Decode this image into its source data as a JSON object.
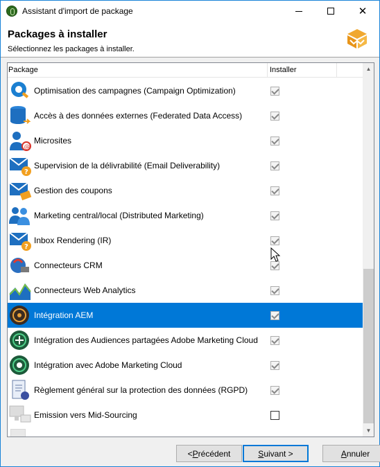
{
  "window": {
    "title": "Assistant d'import de package",
    "buttons": {
      "minimize": "minimize-icon",
      "maximize": "maximize-icon",
      "close": "close-icon"
    }
  },
  "header": {
    "title": "Packages à installer",
    "subtitle": "Sélectionnez les packages à installer.",
    "logo": "package-box-icon"
  },
  "list": {
    "columns": {
      "package": "Package",
      "install": "Installer"
    },
    "rows": [
      {
        "label": "Optimisation des campagnes (Campaign Optimization)",
        "icon": "campaign-optimization-icon",
        "checked": true,
        "selected": false
      },
      {
        "label": "Accès à des données externes (Federated Data Access)",
        "icon": "database-icon",
        "checked": true,
        "selected": false
      },
      {
        "label": "Microsites",
        "icon": "user-at-icon",
        "checked": true,
        "selected": false
      },
      {
        "label": "Supervision de la délivrabilité (Email Deliverability)",
        "icon": "mail-question-icon",
        "checked": true,
        "selected": false
      },
      {
        "label": "Gestion des coupons",
        "icon": "mail-coupon-icon",
        "checked": true,
        "selected": false
      },
      {
        "label": "Marketing central/local (Distributed Marketing)",
        "icon": "users-icon",
        "checked": true,
        "selected": false
      },
      {
        "label": "Inbox Rendering (IR)",
        "icon": "mail-question-icon",
        "checked": true,
        "selected": false
      },
      {
        "label": "Connecteurs CRM",
        "icon": "crm-connector-icon",
        "checked": true,
        "selected": false
      },
      {
        "label": "Connecteurs Web Analytics",
        "icon": "web-analytics-icon",
        "checked": true,
        "selected": false
      },
      {
        "label": "Intégration AEM",
        "icon": "aem-icon",
        "checked": true,
        "selected": true
      },
      {
        "label": "Intégration des Audiences partagées Adobe Marketing Cloud",
        "icon": "audience-icon",
        "checked": true,
        "selected": false
      },
      {
        "label": "Intégration avec Adobe Marketing Cloud",
        "icon": "marketing-cloud-icon",
        "checked": true,
        "selected": false
      },
      {
        "label": "Règlement général sur la protection des données (RGPD)",
        "icon": "gdpr-document-icon",
        "checked": true,
        "selected": false
      },
      {
        "label": "Emission vers Mid-Sourcing",
        "icon": "mid-sourcing-icon",
        "checked": false,
        "selected": false
      }
    ]
  },
  "footer": {
    "prev": {
      "pre": "< ",
      "key": "P",
      "post": "récédent"
    },
    "next": {
      "pre": "",
      "key": "S",
      "post": "uivant >"
    },
    "cancel": {
      "pre": "",
      "key": "A",
      "post": "nnuler"
    }
  }
}
